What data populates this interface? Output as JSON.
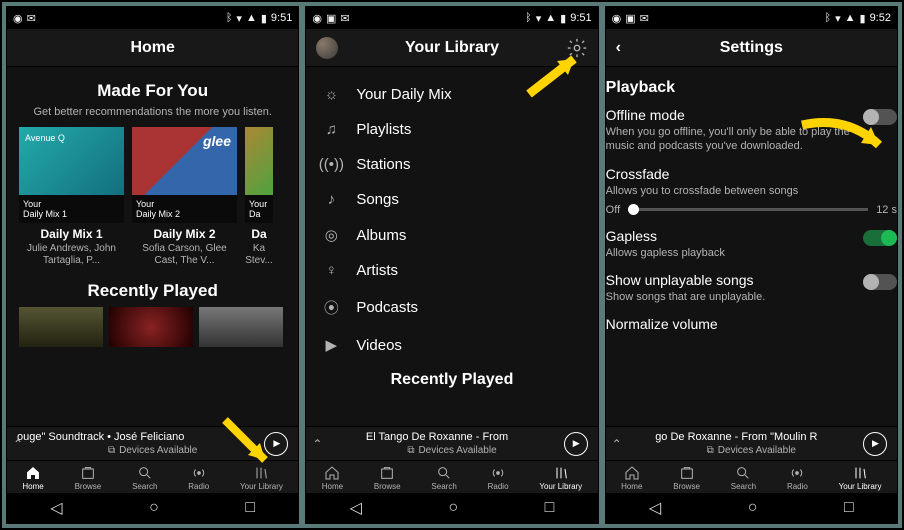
{
  "status": {
    "time": "9:51",
    "time3": "9:52"
  },
  "screen1": {
    "title": "Home",
    "madeForYou": {
      "title": "Made For You",
      "subtitle": "Get better recommendations the more you listen.",
      "cards": [
        {
          "cover_label": "Your\nDaily Mix 1",
          "title": "Daily Mix 1",
          "sub": "Julie Andrews, John Tartaglia, P..."
        },
        {
          "cover_label": "Your\nDaily Mix 2",
          "title": "Daily Mix 2",
          "sub": "Sofia Carson, Glee Cast, The V..."
        },
        {
          "cover_label": "Your\nDa",
          "title": "Da",
          "sub": "Ka\nStev..."
        }
      ]
    },
    "recently": {
      "title": "Recently Played"
    },
    "nowplaying": {
      "line1": "ouge\" Soundtrack • José Feliciano",
      "devices": "Devices Available"
    }
  },
  "screen2": {
    "title": "Your Library",
    "items": [
      {
        "icon": "daily-mix",
        "label": "Your Daily Mix"
      },
      {
        "icon": "playlist",
        "label": "Playlists"
      },
      {
        "icon": "stations",
        "label": "Stations"
      },
      {
        "icon": "songs",
        "label": "Songs"
      },
      {
        "icon": "albums",
        "label": "Albums"
      },
      {
        "icon": "artists",
        "label": "Artists"
      },
      {
        "icon": "podcasts",
        "label": "Podcasts"
      },
      {
        "icon": "videos",
        "label": "Videos"
      }
    ],
    "recently": "Recently Played",
    "nowplaying": {
      "line1": "El Tango De Roxanne - From",
      "devices": "Devices Available"
    }
  },
  "screen3": {
    "title": "Settings",
    "section": "Playback",
    "rows": {
      "offline": {
        "label": "Offline mode",
        "desc": "When you go offline, you'll only be able to play the music and podcasts you've downloaded.",
        "on": false
      },
      "crossfade": {
        "label": "Crossfade",
        "desc": "Allows you to crossfade between songs",
        "min": "Off",
        "max": "12 s"
      },
      "gapless": {
        "label": "Gapless",
        "desc": "Allows gapless playback",
        "on": true
      },
      "unplayable": {
        "label": "Show unplayable songs",
        "desc": "Show songs that are unplayable.",
        "on": false
      },
      "normalize": {
        "label": "Normalize volume"
      }
    },
    "nowplaying": {
      "line1": "go De Roxanne - From \"Moulin R",
      "devices": "Devices Available"
    }
  },
  "bottomnav": {
    "items": [
      {
        "label": "Home"
      },
      {
        "label": "Browse"
      },
      {
        "label": "Search"
      },
      {
        "label": "Radio"
      },
      {
        "label": "Your Library"
      }
    ]
  }
}
